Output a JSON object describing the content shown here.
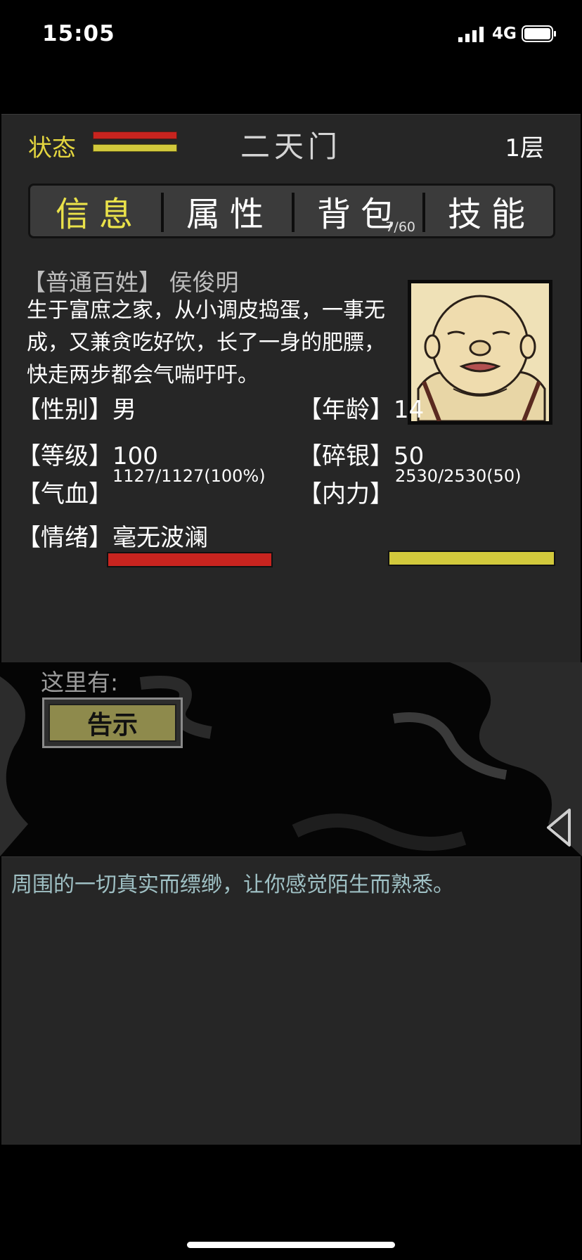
{
  "statusbar": {
    "time": "15:05",
    "network": "4G",
    "icons": [
      "signal-icon",
      "battery-icon"
    ]
  },
  "header": {
    "status_label": "状态",
    "title": "二天门",
    "floor": "1层"
  },
  "tabs": [
    {
      "label": "信息",
      "active": true
    },
    {
      "label": "属性",
      "active": false
    },
    {
      "label": "背包",
      "active": false,
      "count": "7/60"
    },
    {
      "label": "技能",
      "active": false
    }
  ],
  "character": {
    "role": "【普通百姓】 侯俊明",
    "description": "生于富庶之家，从小调皮捣蛋，一事无成，又兼贪吃好饮，长了一身的肥膘，快走两步都会气喘吁吁。",
    "gender_label": "【性别】",
    "gender": "男",
    "age_label": "【年龄】",
    "age": "14",
    "level_label": "【等级】",
    "level": "100",
    "silver_label": "【碎银】",
    "silver": "50",
    "hp_label": "【气血】",
    "hp_text": "1127/1127(100%)",
    "hp_fill": 1.0,
    "mp_label": "【内力】",
    "mp_text": "2530/2530(50)",
    "mp_fill": 1.0,
    "mood_label": "【情绪】",
    "mood": "毫无波澜"
  },
  "scene": {
    "here_label": "这里有:",
    "notice_button": "告示"
  },
  "log": {
    "message": "周围的一切真实而缥缈，让你感觉陌生而熟悉。"
  },
  "colors": {
    "accent_yellow": "#eae24a",
    "hp_red": "#c8241f",
    "mp_yellow": "#d2c93c",
    "log_text": "#9fc0c4"
  }
}
